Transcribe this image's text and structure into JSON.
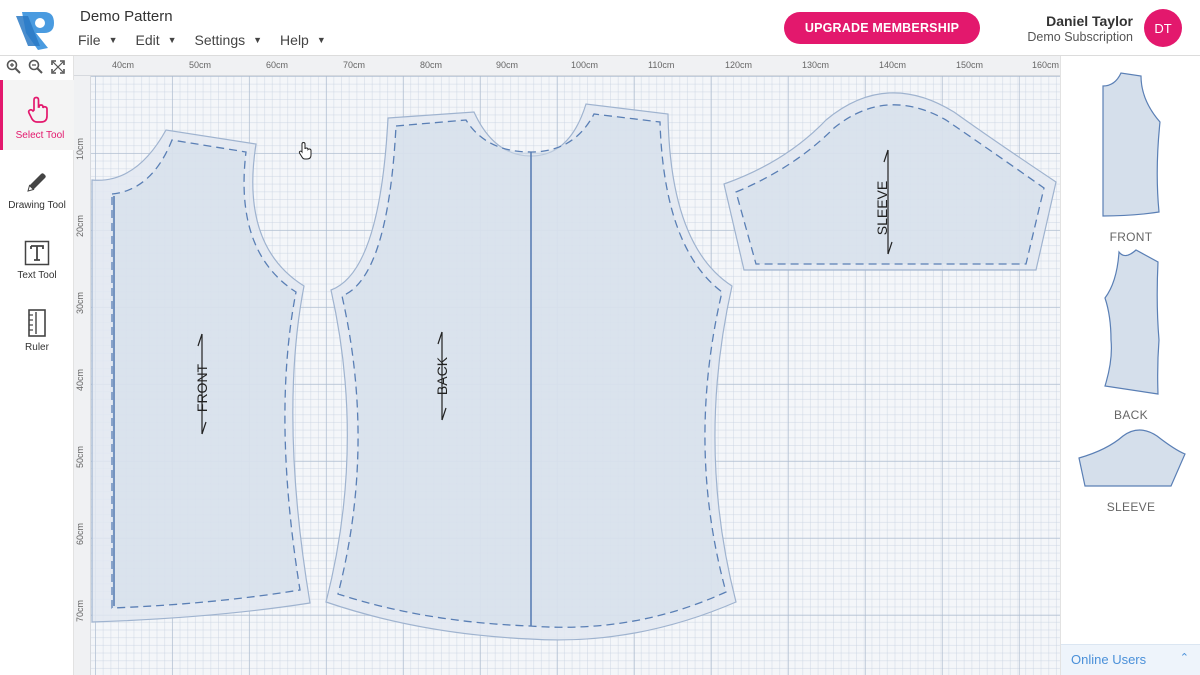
{
  "app": {
    "title": "Demo Pattern",
    "menu": [
      {
        "label": "File"
      },
      {
        "label": "Edit"
      },
      {
        "label": "Settings"
      },
      {
        "label": "Help"
      }
    ],
    "upgrade_label": "UPGRADE MEMBERSHIP",
    "user": {
      "name": "Daniel Taylor",
      "subscription": "Demo Subscription",
      "initials": "DT"
    },
    "accent_color": "#e3186d"
  },
  "toolbar": {
    "zoom_icons": [
      "zoom-in-icon",
      "zoom-out-icon",
      "fit-screen-icon"
    ],
    "tools": [
      {
        "label": "Select Tool",
        "icon": "hand-pointer-icon",
        "active": true
      },
      {
        "label": "Drawing Tool",
        "icon": "pencil-icon",
        "active": false
      },
      {
        "label": "Text Tool",
        "icon": "text-icon",
        "active": false
      },
      {
        "label": "Ruler",
        "icon": "ruler-icon",
        "active": false
      }
    ]
  },
  "canvas": {
    "ruler_top": [
      "40cm",
      "50cm",
      "60cm",
      "70cm",
      "80cm",
      "90cm",
      "100cm",
      "110cm",
      "120cm",
      "130cm",
      "140cm",
      "150cm",
      "160cm"
    ],
    "ruler_left": [
      "10cm",
      "20cm",
      "30cm",
      "40cm",
      "50cm",
      "60cm",
      "70cm"
    ],
    "pieces": [
      {
        "label": "FRONT"
      },
      {
        "label": "BACK"
      },
      {
        "label": "SLEEVE"
      }
    ]
  },
  "right_panel": {
    "thumbnails": [
      {
        "label": "FRONT"
      },
      {
        "label": "BACK"
      },
      {
        "label": "SLEEVE"
      }
    ],
    "online_users_label": "Online Users"
  }
}
